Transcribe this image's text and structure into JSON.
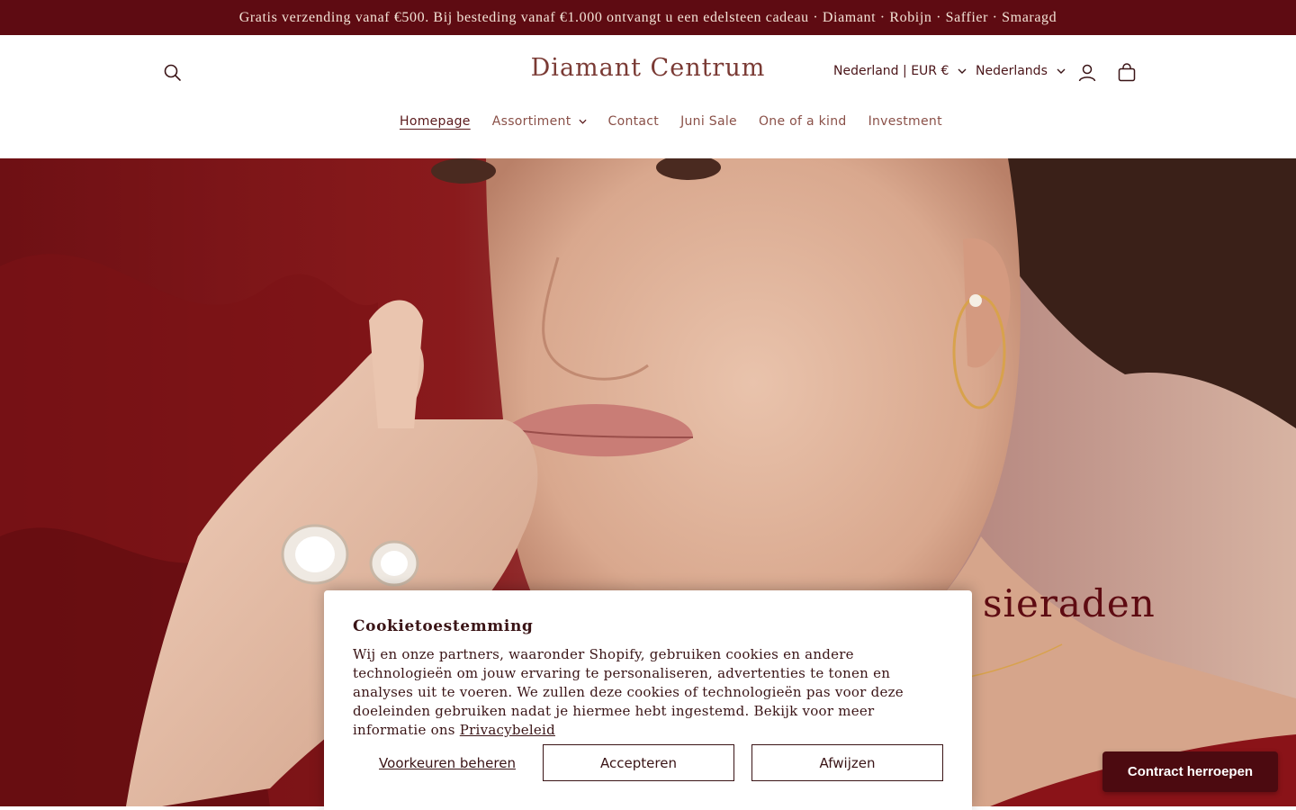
{
  "announcement": {
    "text": "Gratis verzending vanaf €500. Bij besteding vanaf €1.000 ontvangt u een edelsteen cadeau · Diamant · Robijn · Saffier · Smaragd"
  },
  "header": {
    "logo": "Diamant Centrum",
    "country_selector": "Nederland | EUR €",
    "language_selector": "Nederlands",
    "icons": {
      "search": "search-icon",
      "account": "user-icon",
      "cart": "shopping-bag-icon"
    }
  },
  "nav": {
    "items": [
      {
        "label": "Homepage",
        "active": true
      },
      {
        "label": "Assortiment",
        "has_dropdown": true
      },
      {
        "label": "Contact"
      },
      {
        "label": "Juni Sale"
      },
      {
        "label": "One of a kind"
      },
      {
        "label": "Investment"
      }
    ]
  },
  "hero": {
    "heading_visible": "sieraden"
  },
  "cookie_banner": {
    "title": "Cookietoestemming",
    "body": "Wij en onze partners, waaronder Shopify, gebruiken cookies en andere technologieën om jouw ervaring te personaliseren, advertenties te tonen en analyses uit te voeren. We zullen deze cookies of technologieën pas voor deze doeleinden gebruiken nadat je hiermee hebt ingestemd. Bekijk voor meer informatie ons",
    "link": "Privacybeleid",
    "preferences_button": "Voorkeuren beheren",
    "accept_button": "Accepteren",
    "decline_button": "Afwijzen"
  },
  "revoke_button": "Contract herroepen",
  "colors": {
    "announcement_bg": "#5e0b12",
    "brand_text": "#7a3a34",
    "revoke_bg": "#4c0a10"
  }
}
